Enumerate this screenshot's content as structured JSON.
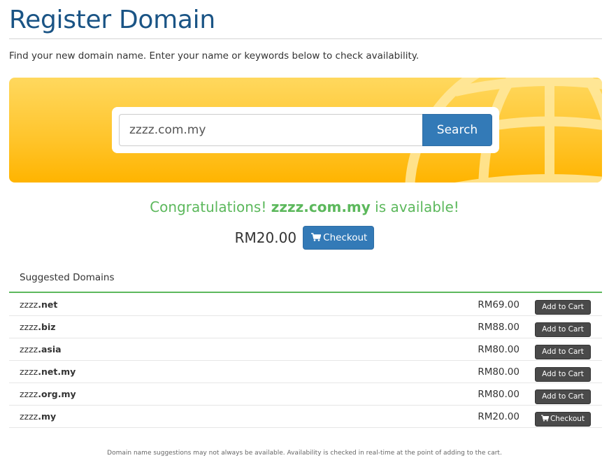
{
  "header": {
    "title": "Register Domain",
    "intro": "Find your new domain name. Enter your name or keywords below to check availability."
  },
  "search": {
    "value": "zzzz.com.my",
    "button_label": "Search"
  },
  "result": {
    "prefix": "Congratulations! ",
    "domain": "zzzz.com.my",
    "suffix": " is available!",
    "price": "RM20.00",
    "checkout_label": "Checkout"
  },
  "suggestions": {
    "header": "Suggested Domains",
    "rows": [
      {
        "name": "zzzz",
        "tld": ".net",
        "price": "RM69.00",
        "action": "Add to Cart"
      },
      {
        "name": "zzzz",
        "tld": ".biz",
        "price": "RM88.00",
        "action": "Add to Cart"
      },
      {
        "name": "zzzz",
        "tld": ".asia",
        "price": "RM80.00",
        "action": "Add to Cart"
      },
      {
        "name": "zzzz",
        "tld": ".net.my",
        "price": "RM80.00",
        "action": "Add to Cart"
      },
      {
        "name": "zzzz",
        "tld": ".org.my",
        "price": "RM80.00",
        "action": "Add to Cart"
      },
      {
        "name": "zzzz",
        "tld": ".my",
        "price": "RM20.00",
        "action": "Checkout"
      }
    ]
  },
  "footnote": "Domain name suggestions may not always be available. Availability is checked in real-time at the point of adding to the cart.",
  "colors": {
    "title": "#1a5485",
    "primary": "#337ab7",
    "success": "#5cb85c",
    "banner": "#ffc42a",
    "dark_button": "#4a4a4a"
  },
  "icons": {
    "cart": "shopping-cart-icon",
    "globe": "globe-icon"
  }
}
